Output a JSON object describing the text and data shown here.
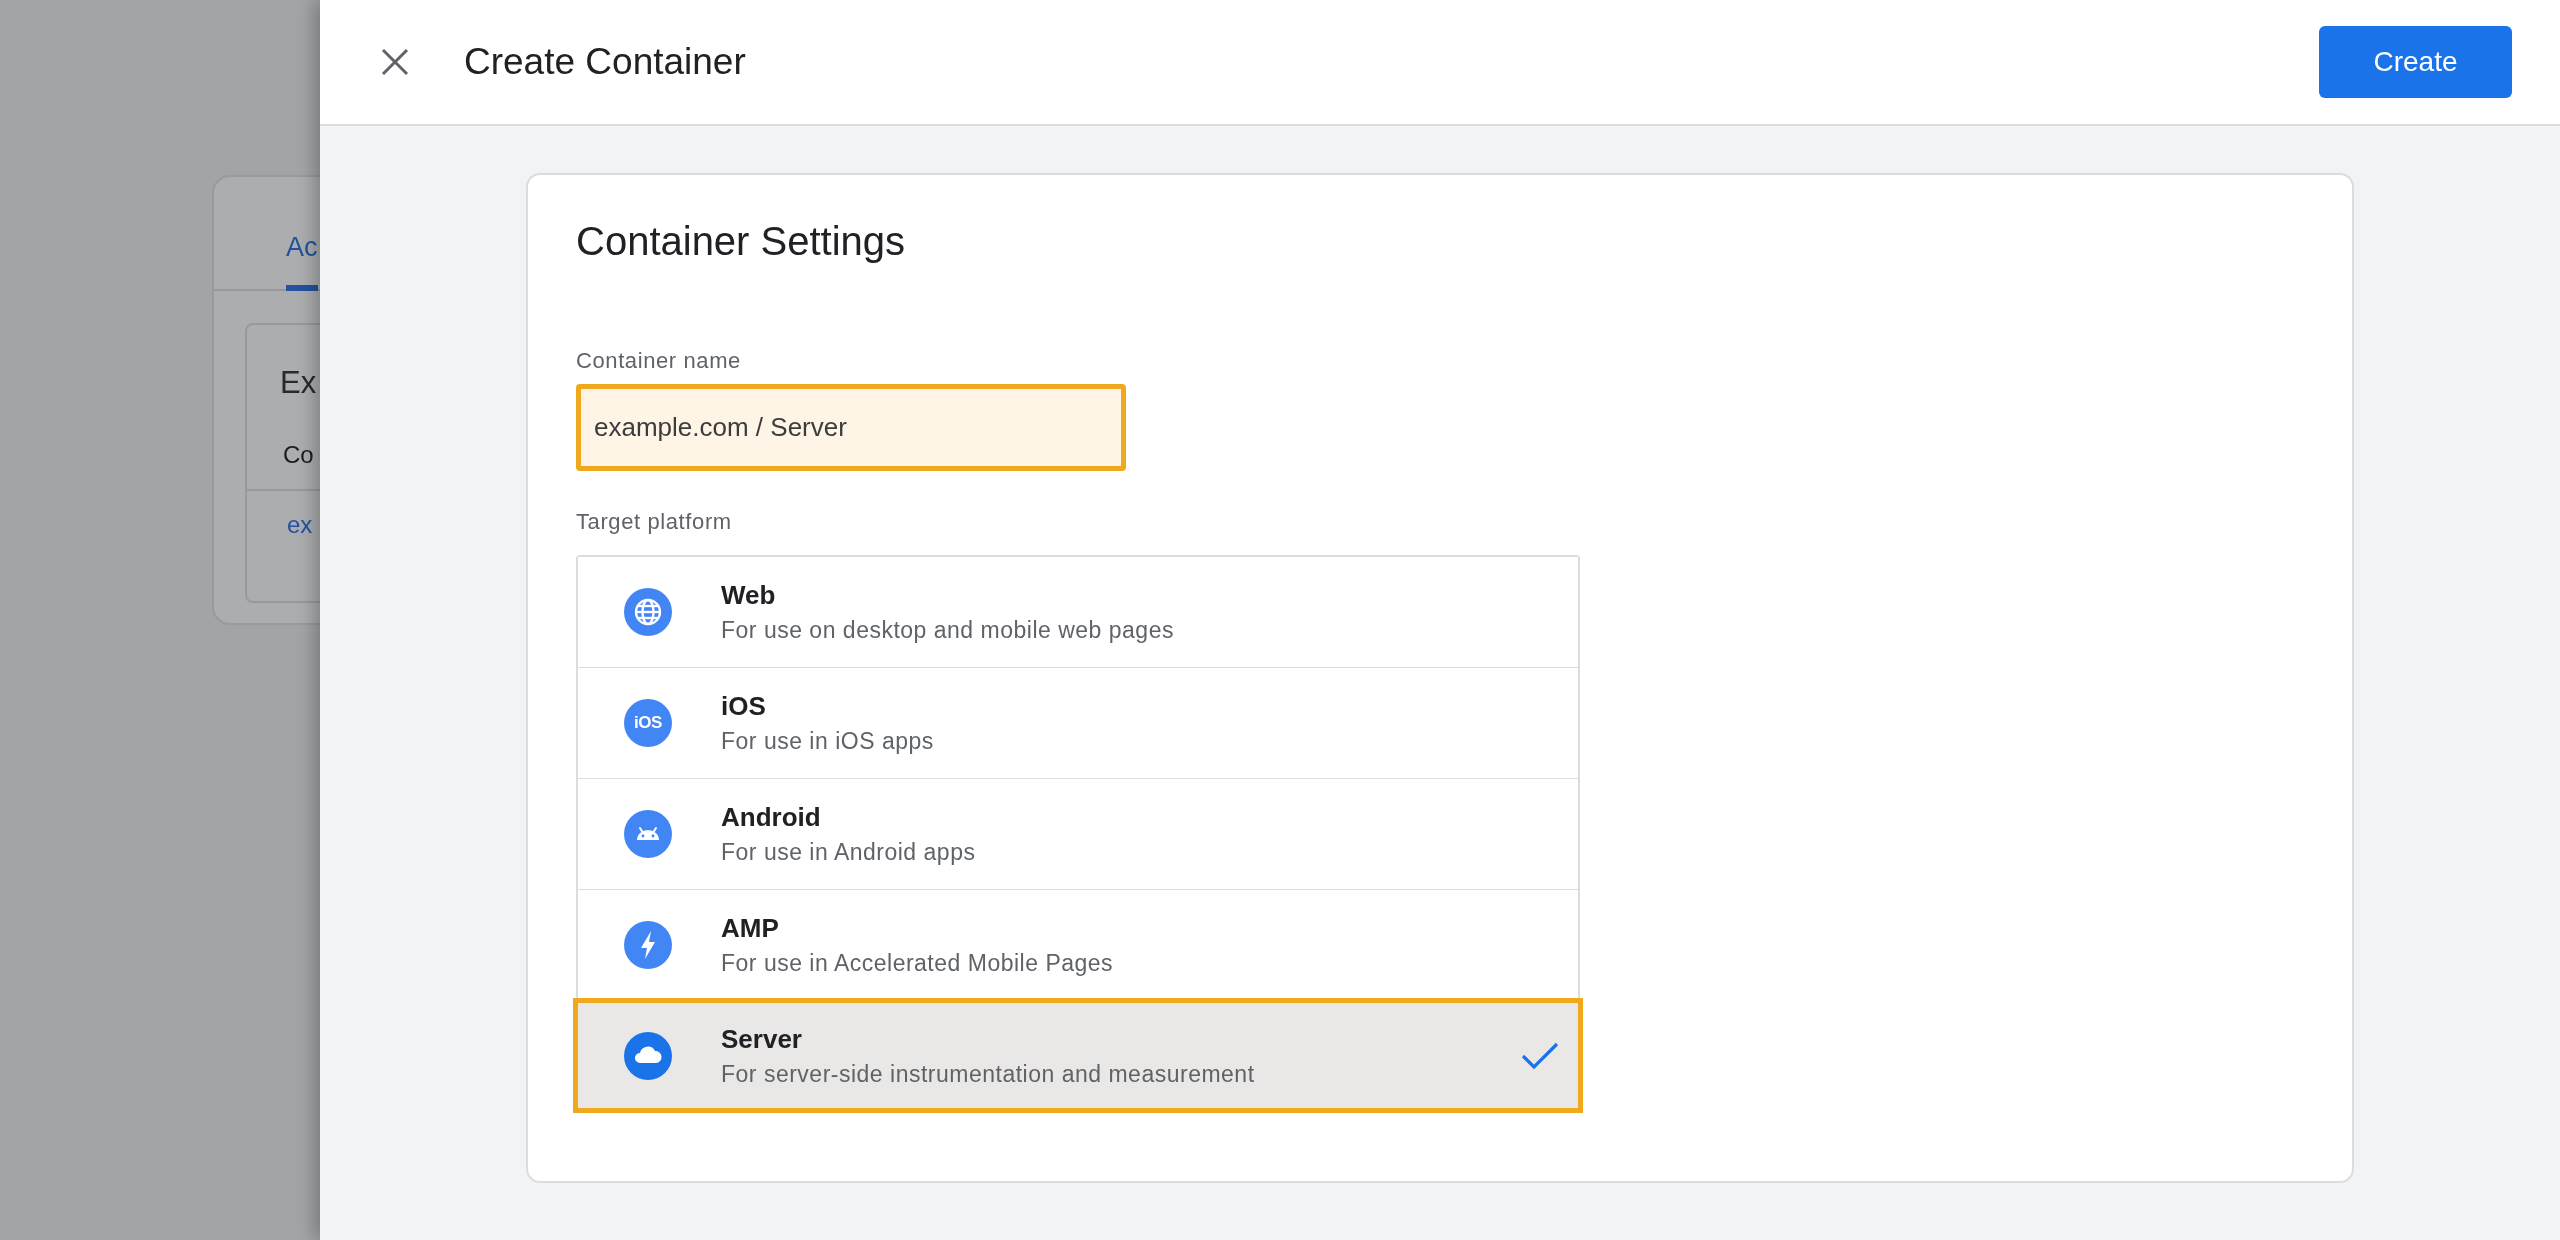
{
  "background": {
    "tab": {
      "label": "Ac",
      "selected": true
    },
    "heading": "Ex",
    "column_label": "Co",
    "link": "ex"
  },
  "dialog": {
    "title": "Create Container",
    "create_button": "Create",
    "settings": {
      "title": "Container Settings",
      "container_name": {
        "label": "Container name",
        "value": "example.com / Server",
        "highlighted": true
      },
      "target_platform": {
        "label": "Target platform",
        "options": [
          {
            "kind": "web",
            "title": "Web",
            "description": "For use on desktop and mobile web pages",
            "selected": false
          },
          {
            "kind": "ios",
            "icon_label": "iOS",
            "title": "iOS",
            "description": "For use in iOS apps",
            "selected": false
          },
          {
            "kind": "android",
            "title": "Android",
            "description": "For use in Android apps",
            "selected": false
          },
          {
            "kind": "amp",
            "title": "AMP",
            "description": "For use in Accelerated Mobile Pages",
            "selected": false
          },
          {
            "kind": "server",
            "title": "Server",
            "description": "For server-side instrumentation and measurement",
            "selected": true
          }
        ]
      }
    }
  }
}
